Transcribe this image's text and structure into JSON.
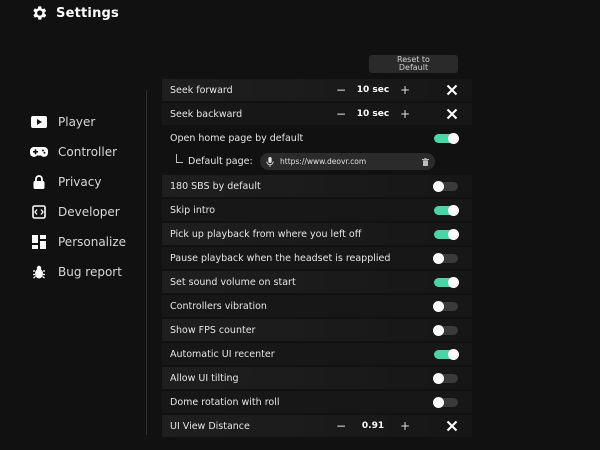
{
  "header": {
    "title": "Settings"
  },
  "sidebar": {
    "items": [
      {
        "label": "Player",
        "icon": "play-icon"
      },
      {
        "label": "Controller",
        "icon": "gamepad-icon"
      },
      {
        "label": "Privacy",
        "icon": "lock-icon"
      },
      {
        "label": "Developer",
        "icon": "developer-icon"
      },
      {
        "label": "Personalize",
        "icon": "personalize-icon"
      },
      {
        "label": "Bug report",
        "icon": "bug-icon"
      }
    ]
  },
  "reset": {
    "line1": "Reset to",
    "line2": "Default"
  },
  "settings": {
    "seek_forward": {
      "label": "Seek forward",
      "value": "10 sec"
    },
    "seek_backward": {
      "label": "Seek backward",
      "value": "10 sec"
    },
    "open_home": {
      "label": "Open home page by default",
      "on": true
    },
    "default_page": {
      "label": "Default page:",
      "url": "https://www.deovr.com"
    },
    "sbs180": {
      "label": "180 SBS by default",
      "on": false
    },
    "skip_intro": {
      "label": "Skip intro",
      "on": true
    },
    "pickup": {
      "label": "Pick up playback from where you left off",
      "on": true
    },
    "pause_headset": {
      "label": "Pause playback when the headset is reapplied",
      "on": false
    },
    "sound_volume": {
      "label": "Set sound volume on start",
      "on": true
    },
    "vibration": {
      "label": "Controllers vibration",
      "on": false
    },
    "fps": {
      "label": "Show FPS counter",
      "on": false
    },
    "ui_recenter": {
      "label": "Automatic UI recenter",
      "on": true
    },
    "ui_tilting": {
      "label": "Allow UI tilting",
      "on": false
    },
    "dome_rotation": {
      "label": "Dome rotation with roll",
      "on": false
    },
    "ui_distance": {
      "label": "UI View Distance",
      "value": "0.91"
    }
  },
  "stepper": {
    "minus": "−",
    "plus": "+"
  },
  "colors": {
    "accent": "#48d6a6",
    "background": "#111111",
    "toggle_off": "#3a3a3a"
  }
}
